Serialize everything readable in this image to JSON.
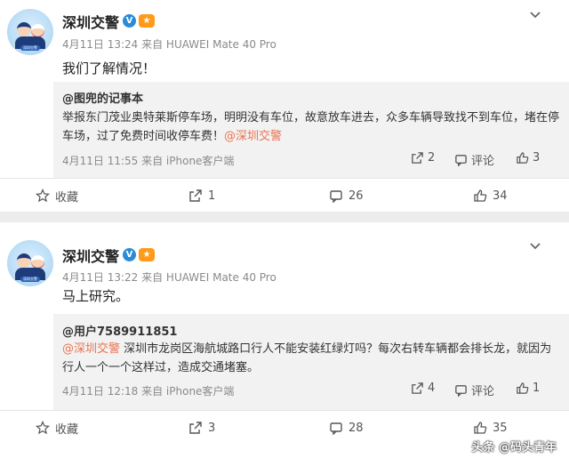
{
  "posts": [
    {
      "author": "深圳交警",
      "verified_badge": "V",
      "medal_icon": "medal-icon",
      "avatar_caption": "深圳交警",
      "meta": "4月11日 13:24 来自 HUAWEI Mate 40 Pro",
      "content": "我们了解情况！",
      "quote": {
        "user": "@图兜的记事本",
        "text": "举报东门茂业奥特莱斯停车场，明明没有车位，故意放车进去，众多车辆导致找不到车位，堵在停车场，过了免费时间收停车费！",
        "mention": "@深圳交警",
        "meta": "4月11日 11:55 来自 iPhone客户端",
        "reposts": "2",
        "comment_label": "评论",
        "likes": "3"
      },
      "actions": {
        "favorite_label": "收藏",
        "reposts": "1",
        "comments": "26",
        "likes": "34"
      }
    },
    {
      "author": "深圳交警",
      "verified_badge": "V",
      "medal_icon": "medal-icon",
      "avatar_caption": "深圳交警",
      "meta": "4月11日 13:22 来自 HUAWEI Mate 40 Pro",
      "content": "马上研究。",
      "quote": {
        "user": "@用户7589911851",
        "mention": "@深圳交警",
        "text": " 深圳市龙岗区海航城路口行人不能安装红绿灯吗？每次右转车辆都会排长龙，就因为行人一个一个这样过，造成交通堵塞。",
        "meta": "4月11日 12:18 来自 iPhone客户端",
        "reposts": "4",
        "comment_label": "评论",
        "likes": "1"
      },
      "actions": {
        "favorite_label": "收藏",
        "reposts": "3",
        "comments": "28",
        "likes": "35"
      }
    }
  ],
  "watermark": "头条 @码头青年",
  "colors": {
    "mention": "#eb7350",
    "verified": "#2a8bd8",
    "medal": "#ff9a1a",
    "page_bg": "#ececec"
  }
}
